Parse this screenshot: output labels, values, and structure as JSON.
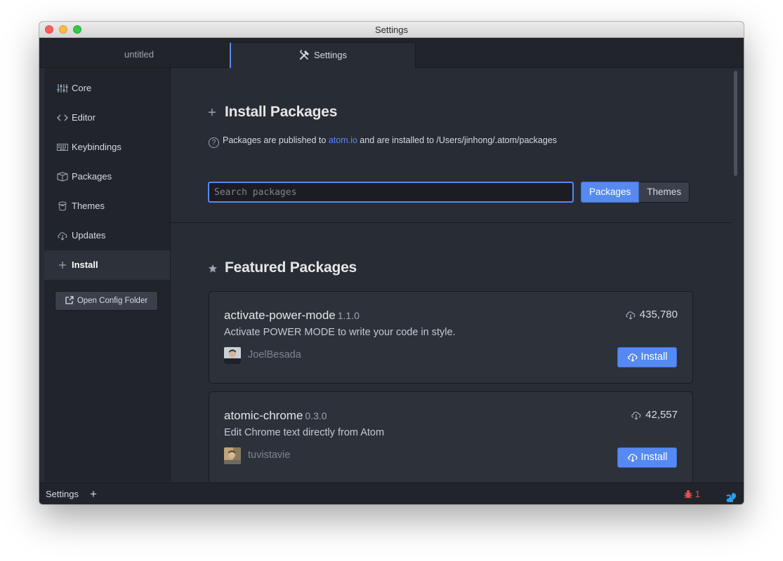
{
  "window": {
    "title": "Settings"
  },
  "tabs": [
    {
      "label": "untitled"
    },
    {
      "label": "Settings"
    }
  ],
  "sidebar": {
    "items": [
      {
        "label": "Core",
        "icon": "sliders-icon"
      },
      {
        "label": "Editor",
        "icon": "code-icon"
      },
      {
        "label": "Keybindings",
        "icon": "keyboard-icon"
      },
      {
        "label": "Packages",
        "icon": "package-icon"
      },
      {
        "label": "Themes",
        "icon": "paintcan-icon"
      },
      {
        "label": "Updates",
        "icon": "cloud-download-icon"
      },
      {
        "label": "Install",
        "icon": "plus-icon",
        "active": true
      }
    ],
    "open_config_label": "Open Config Folder"
  },
  "install": {
    "title": "Install Packages",
    "info_prefix": "Packages are published to",
    "info_link": "atom.io",
    "info_suffix": "and are installed to /Users/jinhong/.atom/packages",
    "search_placeholder": "Search packages",
    "toggle_packages": "Packages",
    "toggle_themes": "Themes"
  },
  "featured": {
    "title": "Featured Packages",
    "packages": [
      {
        "name": "activate-power-mode",
        "version": "1.1.0",
        "description": "Activate POWER MODE to write your code in style.",
        "downloads": "435,780",
        "author": "JoelBesada",
        "install_label": "Install"
      },
      {
        "name": "atomic-chrome",
        "version": "0.3.0",
        "description": "Edit Chrome text directly from Atom",
        "downloads": "42,557",
        "author": "tuvistavie",
        "install_label": "Install"
      }
    ]
  },
  "statusbar": {
    "title": "Settings",
    "plus": "+",
    "bug_count": "1"
  },
  "colors": {
    "accent": "#568af2",
    "background": "#282c34",
    "sidebar": "#21252b",
    "error": "#e05252"
  }
}
